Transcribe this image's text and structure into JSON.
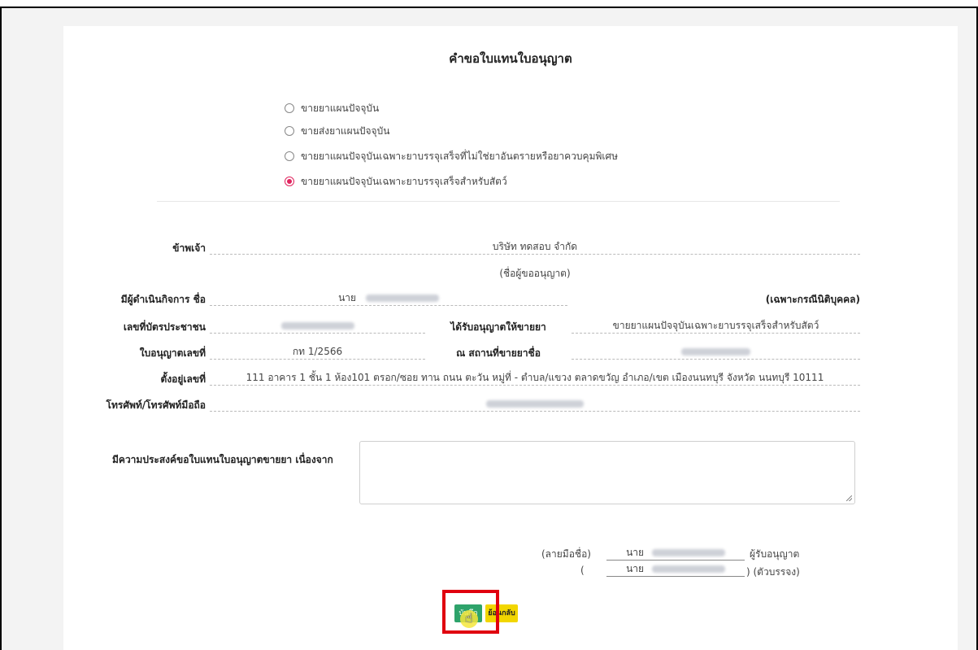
{
  "form": {
    "title": "คำขอใบแทนใบอนุญาต",
    "options": [
      {
        "label": "ขายยาแผนปัจจุบัน",
        "selected": false
      },
      {
        "label": "ขายส่งยาแผนปัจจุบัน",
        "selected": false
      },
      {
        "label": "ขายยาแผนปัจจุบันเฉพาะยาบรรจุเสร็จที่ไม่ใช่ยาอันตรายหรือยาควบคุมพิเศษ",
        "selected": false
      },
      {
        "label": "ขายยาแผนปัจจุบันเฉพาะยาบรรจุเสร็จสำหรับสัตว์",
        "selected": true
      }
    ],
    "applicant_label": "ข้าพเจ้า",
    "applicant_value": "บริษัท ทดสอบ จำกัด",
    "applicant_caption": "(ชื่อผู้ขออนุญาต)",
    "operator_label": "มีผู้ดำเนินกิจการ ชื่อ",
    "operator_prefix": "นาย",
    "operator_note": "(เฉพาะกรณีนิติบุคคล)",
    "id_label": "เลขที่บัตรประชาชน",
    "licensed_label": "ได้รับอนุญาตให้ขายยา",
    "licensed_value": "ขายยาแผนปัจจุบันเฉพาะยาบรรจุเสร็จสำหรับสัตว์",
    "license_no_label": "ใบอนุญาตเลขที่",
    "license_no_value": "กท 1/2566",
    "place_label": "ณ สถานที่ขายยาชื่อ",
    "address_label": "ตั้งอยู่เลขที่",
    "address_value": "111 อาคาร 1 ชั้น 1 ห้อง101 ตรอก/ซอย ทาน ถนน ตะวัน หมู่ที่ - ตำบล/แขวง ตลาดขวัญ อำเภอ/เขต เมืองนนทบุรี จังหวัด นนทบุรี 10111",
    "phone_label": "โทรศัพท์/โทรศัพท์มือถือ",
    "purpose_label": "มีความประสงค์ขอใบแทนใบอนุญาตขายยา เนื่องจาก",
    "purpose_value": "",
    "sign_label": "(ลายมือชื่อ)",
    "sign_prefix": "นาย",
    "sign_role": "ผู้รับอนุญาต",
    "print_open": "(",
    "print_prefix": "นาย",
    "print_role": ") (ตัวบรรจง)"
  },
  "buttons": {
    "save_label": "บันทึก",
    "back_label": "ย้อนกลับ"
  },
  "colors": {
    "save": "#2ea36b",
    "back": "#f2d600",
    "highlight": "#e0000f",
    "radio_selected": "#e0245e"
  }
}
